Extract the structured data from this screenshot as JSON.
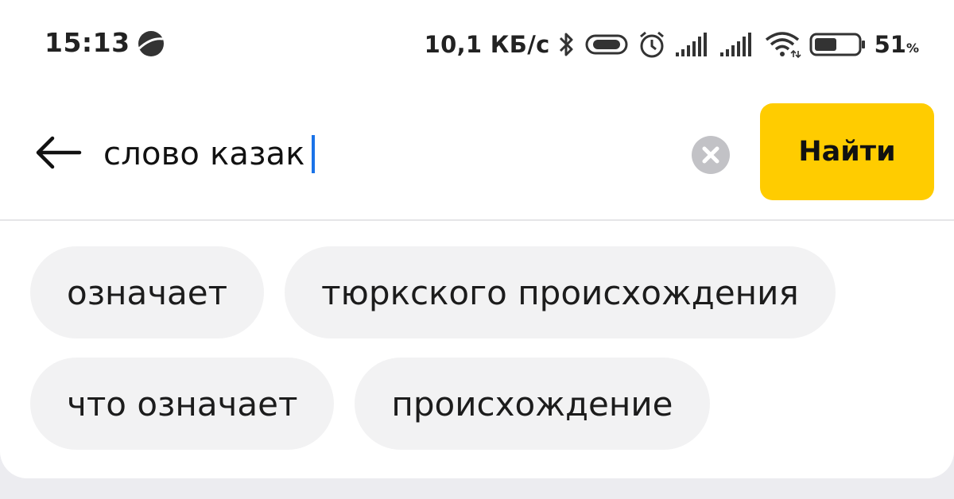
{
  "status_bar": {
    "time": "15:13",
    "network_speed": "10,1 КБ/с",
    "battery_percent": "51",
    "battery_unit": "%",
    "battery_level": 0.51,
    "icons": [
      "planet-icon",
      "bluetooth-icon",
      "vibrate-icon",
      "alarm-icon",
      "signal-icon",
      "signal-icon",
      "wifi-icon",
      "battery-icon"
    ]
  },
  "search": {
    "query": "слово казак",
    "submit_label": "Найти",
    "accent_color": "#ffcc00",
    "caret_color": "#1a73e8"
  },
  "suggestions": [
    [
      "означает",
      "тюркского происхождения"
    ],
    [
      "что означает",
      "происхождение"
    ]
  ]
}
